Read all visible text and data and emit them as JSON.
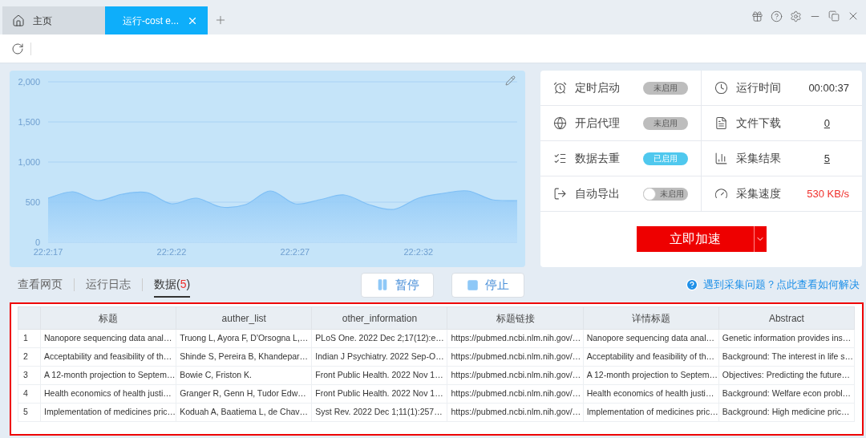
{
  "tabs": [
    {
      "label": "主页",
      "selected": false
    },
    {
      "label": "运行-cost e...",
      "selected": true
    }
  ],
  "chart_data": {
    "type": "area",
    "grid": true,
    "categories": [
      "22:2:17",
      null,
      null,
      null,
      null,
      "22:2:22",
      null,
      null,
      null,
      null,
      "22:2:27",
      null,
      null,
      null,
      null,
      "22:2:32",
      null,
      null,
      null,
      null
    ],
    "series": [
      {
        "color": "#7fbff5",
        "values": [
          550,
          630,
          520,
          600,
          620,
          480,
          550,
          440,
          470,
          640,
          480,
          530,
          590,
          470,
          410,
          550,
          610,
          640,
          530,
          520
        ]
      }
    ],
    "ylim": [
      0,
      2000
    ],
    "yticks": [
      {
        "value": 0,
        "label": "0"
      },
      {
        "value": 500,
        "label": "500"
      },
      {
        "value": 1000,
        "label": "1,000"
      },
      {
        "value": 1500,
        "label": "1,500"
      },
      {
        "value": 2000,
        "label": "2,000"
      }
    ]
  },
  "stats": [
    {
      "label": "定时启动",
      "kind": "badge",
      "on": false,
      "status": "未启用"
    },
    {
      "label": "运行时间",
      "kind": "plain",
      "value": "00:00:37"
    },
    {
      "label": "开启代理",
      "kind": "badge",
      "on": false,
      "status": "未启用"
    },
    {
      "label": "文件下载",
      "kind": "link",
      "value": "0"
    },
    {
      "label": "数据去重",
      "kind": "badge",
      "on": true,
      "status": "已启用"
    },
    {
      "label": "采集结果",
      "kind": "link",
      "value": "5"
    },
    {
      "label": "自动导出",
      "kind": "switch",
      "on": false,
      "status": "未启用"
    },
    {
      "label": "采集速度",
      "kind": "warning",
      "value": "530 KB/s"
    }
  ],
  "boost_button": "立即加速",
  "view_tabs": [
    {
      "label": "查看网页",
      "selected": false
    },
    {
      "label": "运行日志",
      "selected": false
    },
    {
      "label": "数据",
      "open": "(",
      "count": "5",
      "close": ")",
      "selected": true
    }
  ],
  "controls": [
    {
      "label": "暂停",
      "kind": "pause"
    },
    {
      "label": "停止",
      "kind": "stop"
    }
  ],
  "help_link": "遇到采集问题？点此查看如何解决",
  "table": {
    "columns": [
      "标题",
      "auther_list",
      "other_information",
      "标题链接",
      "详情标题",
      "Abstract"
    ],
    "rows": [
      {
        "index": "1",
        "cells": [
          "Nanopore sequencing data anal…",
          "Truong L, Ayora F, D'Orsogna L,…",
          "PLoS One. 2022 Dec 2;17(12):e…",
          "https://pubmed.ncbi.nlm.nih.gov/…",
          "Nanopore sequencing data anal…",
          "Genetic information provides ins…"
        ]
      },
      {
        "index": "2",
        "cells": [
          "Acceptability and feasibility of th…",
          "Shinde S, Pereira B, Khandepar…",
          "Indian J Psychiatry. 2022 Sep-O…",
          "https://pubmed.ncbi.nlm.nih.gov/…",
          "Acceptability and feasibility of th…",
          "Background: The interest in life s…"
        ]
      },
      {
        "index": "3",
        "cells": [
          "A 12-month projection to Septem…",
          "Bowie C, Friston K.",
          "Front Public Health. 2022 Nov 1…",
          "https://pubmed.ncbi.nlm.nih.gov/…",
          "A 12-month projection to Septem…",
          "Objectives: Predicting the future…"
        ]
      },
      {
        "index": "4",
        "cells": [
          "Health economics of health justi…",
          "Granger R, Genn H, Tudor Edw…",
          "Front Public Health. 2022 Nov 1…",
          "https://pubmed.ncbi.nlm.nih.gov/…",
          "Health economics of health justi…",
          "Background: Welfare econ probl…"
        ]
      },
      {
        "index": "5",
        "cells": [
          "Implementation of medicines pric…",
          "Koduah A, Baatiema L, de Chav…",
          "Syst Rev. 2022 Dec 1;11(1):257…",
          "https://pubmed.ncbi.nlm.nih.gov/…",
          "Implementation of medicines pric…",
          "Background: High medicine pric…"
        ]
      }
    ]
  }
}
